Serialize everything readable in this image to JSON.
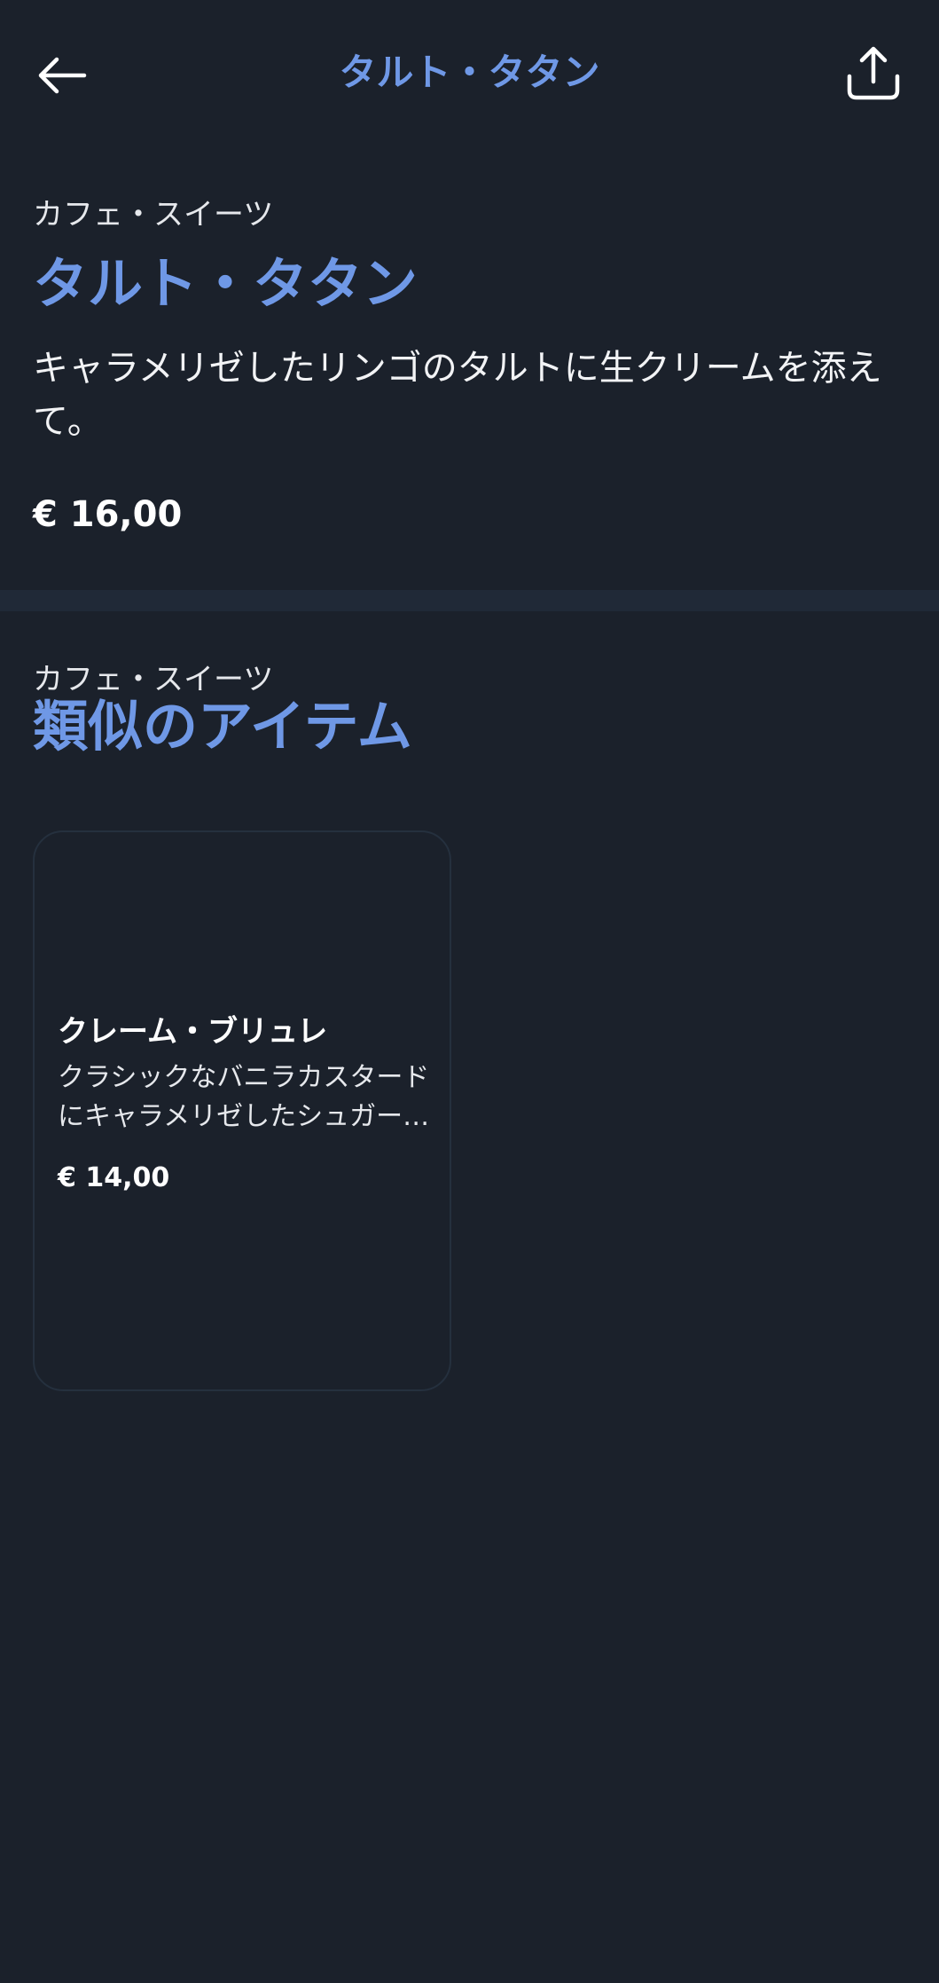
{
  "header": {
    "title": "タルト・タタン",
    "back_icon": "arrow-left-icon",
    "share_icon": "share-icon"
  },
  "item": {
    "category": "カフェ・スイーツ",
    "name": "タルト・タタン",
    "description": "キャラメリゼしたリンゴのタルトに生クリームを添えて。",
    "price": "€ 16,00"
  },
  "similar": {
    "category": "カフェ・スイーツ",
    "heading": "類似のアイテム",
    "items": [
      {
        "name": "クレーム・ブリュレ",
        "description": "クラシックなバニラカスタードにキャラメリゼしたシュガートップ。",
        "price": "€ 14,00"
      }
    ]
  },
  "colors": {
    "background": "#1b212b",
    "accent": "#6f98e6",
    "divider": "#202937",
    "card_border": "#25303e"
  }
}
